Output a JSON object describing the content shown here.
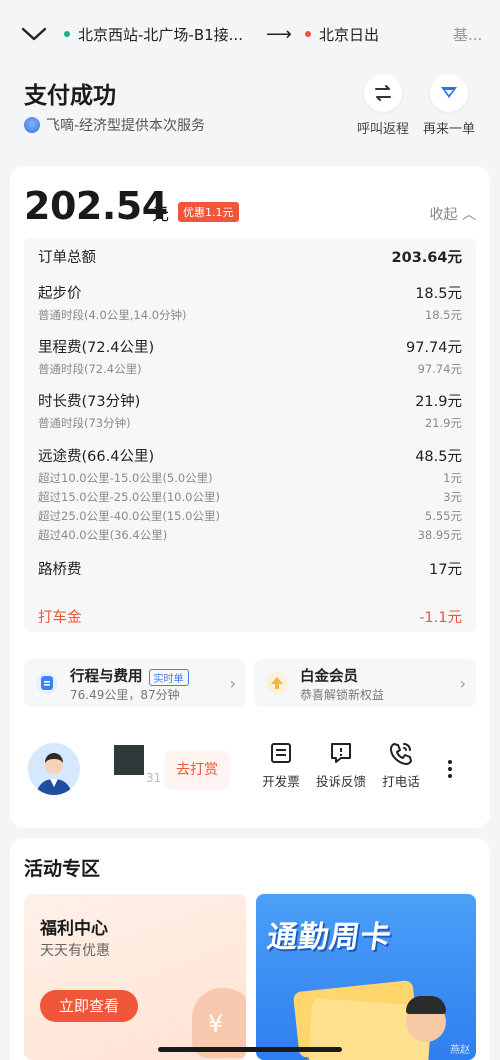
{
  "header": {
    "from": "北京西站-北广场-B1接...",
    "to": "北京日出",
    "to_tail": "基..."
  },
  "status": {
    "title": "支付成功",
    "provider": "飞嘀-经济型提供本次服务"
  },
  "top_actions": [
    {
      "label": "呼叫返程"
    },
    {
      "label": "再来一单"
    }
  ],
  "fare": {
    "amount": "202.54",
    "unit": "元",
    "discount_badge": "优惠1.1元",
    "collapse_label": "收起"
  },
  "breakdown": {
    "total": {
      "label": "订单总额",
      "value": "203.64元"
    },
    "base": {
      "label": "起步价",
      "value": "18.5元",
      "sub_label": "普通时段(4.0公里,14.0分钟)",
      "sub_value": "18.5元"
    },
    "mileage": {
      "label": "里程费(72.4公里)",
      "value": "97.74元",
      "sub_label": "普通时段(72.4公里)",
      "sub_value": "97.74元"
    },
    "duration": {
      "label": "时长费(73分钟)",
      "value": "21.9元",
      "sub_label": "普通时段(73分钟)",
      "sub_value": "21.9元"
    },
    "long_distance": {
      "label": "远途费(66.4公里)",
      "value": "48.5元",
      "items": [
        {
          "label": "超过10.0公里-15.0公里(5.0公里)",
          "value": "1元"
        },
        {
          "label": "超过15.0公里-25.0公里(10.0公里)",
          "value": "3元"
        },
        {
          "label": "超过25.0公里-40.0公里(15.0公里)",
          "value": "5.55元"
        },
        {
          "label": "超过40.0公里(36.4公里)",
          "value": "38.95元"
        }
      ]
    },
    "toll": {
      "label": "路桥费",
      "value": "17元"
    },
    "coupon": {
      "label": "打车金",
      "value": "-1.1元"
    }
  },
  "trip_card": {
    "title": "行程与费用",
    "tag": "实时单",
    "sub": "76.49公里，87分钟"
  },
  "member_card": {
    "title": "白金会员",
    "sub": "恭喜解锁新权益"
  },
  "driver": {
    "plate_faint": "31",
    "tip_label": "去打赏"
  },
  "actions": [
    {
      "label": "开发票"
    },
    {
      "label": "投诉反馈"
    },
    {
      "label": "打电话"
    }
  ],
  "activity": {
    "title": "活动专区",
    "welfare_title": "福利中心",
    "welfare_sub": "天天有优惠",
    "welfare_btn": "立即查看",
    "commute_title": "通勤周卡",
    "commute_corner": "燕赵"
  },
  "colors": {
    "accent": "#f0563a",
    "blue": "#3b82f6",
    "bg": "#f4f5f7"
  }
}
